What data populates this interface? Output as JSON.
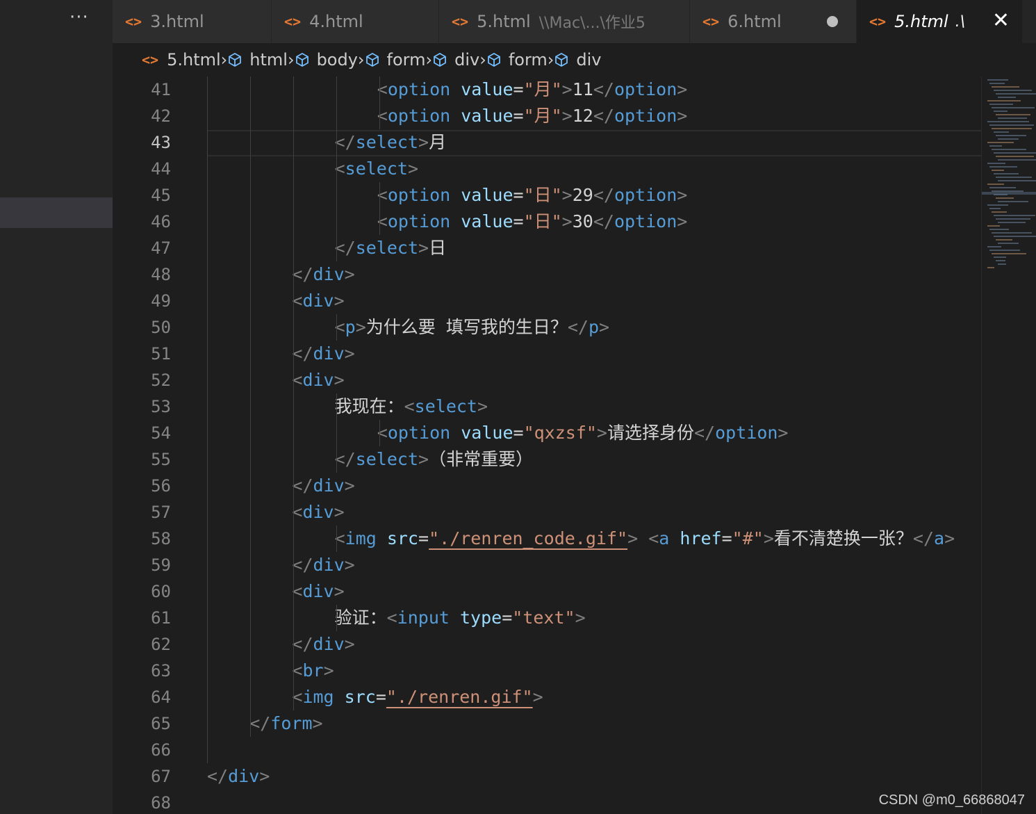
{
  "tabs": [
    {
      "label": "3.html",
      "description": "",
      "active": false,
      "dirty": false
    },
    {
      "label": "4.html",
      "description": "",
      "active": false,
      "dirty": false
    },
    {
      "label": "5.html",
      "description": "\\\\Mac\\...\\作业5",
      "active": false,
      "dirty": false
    },
    {
      "label": "6.html",
      "description": "",
      "active": false,
      "dirty": true
    },
    {
      "label": "5.html",
      "description": ".\\",
      "active": true,
      "dirty": false
    }
  ],
  "breadcrumbs": [
    {
      "label": "5.html",
      "icon": "html-file-icon"
    },
    {
      "label": "html",
      "icon": "cube-icon"
    },
    {
      "label": "body",
      "icon": "cube-icon"
    },
    {
      "label": "form",
      "icon": "cube-icon"
    },
    {
      "label": "div",
      "icon": "cube-icon"
    },
    {
      "label": "form",
      "icon": "cube-icon"
    },
    {
      "label": "div",
      "icon": "cube-icon"
    }
  ],
  "current_line": 43,
  "code_lines": [
    {
      "n": 41,
      "indent": 8,
      "tokens": [
        [
          "br",
          "<"
        ],
        [
          "tag",
          "option"
        ],
        [
          "tx",
          " "
        ],
        [
          "at",
          "value"
        ],
        [
          "tx",
          "="
        ],
        [
          "st",
          "\"月\""
        ],
        [
          "br",
          ">"
        ],
        [
          "tx",
          "11"
        ],
        [
          "br",
          "</"
        ],
        [
          "tag",
          "option"
        ],
        [
          "br",
          ">"
        ]
      ]
    },
    {
      "n": 42,
      "indent": 8,
      "tokens": [
        [
          "br",
          "<"
        ],
        [
          "tag",
          "option"
        ],
        [
          "tx",
          " "
        ],
        [
          "at",
          "value"
        ],
        [
          "tx",
          "="
        ],
        [
          "st",
          "\"月\""
        ],
        [
          "br",
          ">"
        ],
        [
          "tx",
          "12"
        ],
        [
          "br",
          "</"
        ],
        [
          "tag",
          "option"
        ],
        [
          "br",
          ">"
        ]
      ]
    },
    {
      "n": 43,
      "indent": 6,
      "tokens": [
        [
          "br",
          "</"
        ],
        [
          "tag",
          "select"
        ],
        [
          "br",
          ">"
        ],
        [
          "tx",
          "月"
        ]
      ]
    },
    {
      "n": 44,
      "indent": 6,
      "tokens": [
        [
          "br",
          "<"
        ],
        [
          "tag",
          "select"
        ],
        [
          "br",
          ">"
        ]
      ]
    },
    {
      "n": 45,
      "indent": 8,
      "tokens": [
        [
          "br",
          "<"
        ],
        [
          "tag",
          "option"
        ],
        [
          "tx",
          " "
        ],
        [
          "at",
          "value"
        ],
        [
          "tx",
          "="
        ],
        [
          "st",
          "\"日\""
        ],
        [
          "br",
          ">"
        ],
        [
          "tx",
          "29"
        ],
        [
          "br",
          "</"
        ],
        [
          "tag",
          "option"
        ],
        [
          "br",
          ">"
        ]
      ]
    },
    {
      "n": 46,
      "indent": 8,
      "tokens": [
        [
          "br",
          "<"
        ],
        [
          "tag",
          "option"
        ],
        [
          "tx",
          " "
        ],
        [
          "at",
          "value"
        ],
        [
          "tx",
          "="
        ],
        [
          "st",
          "\"日\""
        ],
        [
          "br",
          ">"
        ],
        [
          "tx",
          "30"
        ],
        [
          "br",
          "</"
        ],
        [
          "tag",
          "option"
        ],
        [
          "br",
          ">"
        ]
      ]
    },
    {
      "n": 47,
      "indent": 6,
      "tokens": [
        [
          "br",
          "</"
        ],
        [
          "tag",
          "select"
        ],
        [
          "br",
          ">"
        ],
        [
          "tx",
          "日"
        ]
      ]
    },
    {
      "n": 48,
      "indent": 4,
      "tokens": [
        [
          "br",
          "</"
        ],
        [
          "tag",
          "div"
        ],
        [
          "br",
          ">"
        ]
      ]
    },
    {
      "n": 49,
      "indent": 4,
      "tokens": [
        [
          "br",
          "<"
        ],
        [
          "tag",
          "div"
        ],
        [
          "br",
          ">"
        ]
      ]
    },
    {
      "n": 50,
      "indent": 6,
      "tokens": [
        [
          "br",
          "<"
        ],
        [
          "tag",
          "p"
        ],
        [
          "br",
          ">"
        ],
        [
          "tx",
          "为什么要 填写我的生日？"
        ],
        [
          "br",
          "</"
        ],
        [
          "tag",
          "p"
        ],
        [
          "br",
          ">"
        ]
      ]
    },
    {
      "n": 51,
      "indent": 4,
      "tokens": [
        [
          "br",
          "</"
        ],
        [
          "tag",
          "div"
        ],
        [
          "br",
          ">"
        ]
      ]
    },
    {
      "n": 52,
      "indent": 4,
      "tokens": [
        [
          "br",
          "<"
        ],
        [
          "tag",
          "div"
        ],
        [
          "br",
          ">"
        ]
      ]
    },
    {
      "n": 53,
      "indent": 6,
      "tokens": [
        [
          "tx",
          "我现在："
        ],
        [
          "br",
          "<"
        ],
        [
          "tag",
          "select"
        ],
        [
          "br",
          ">"
        ]
      ]
    },
    {
      "n": 54,
      "indent": 8,
      "tokens": [
        [
          "br",
          "<"
        ],
        [
          "tag",
          "option"
        ],
        [
          "tx",
          " "
        ],
        [
          "at",
          "value"
        ],
        [
          "tx",
          "="
        ],
        [
          "st",
          "\"qxzsf\""
        ],
        [
          "br",
          ">"
        ],
        [
          "tx",
          "请选择身份"
        ],
        [
          "br",
          "</"
        ],
        [
          "tag",
          "option"
        ],
        [
          "br",
          ">"
        ]
      ]
    },
    {
      "n": 55,
      "indent": 6,
      "tokens": [
        [
          "br",
          "</"
        ],
        [
          "tag",
          "select"
        ],
        [
          "br",
          ">"
        ],
        [
          "tx",
          "（非常重要）"
        ]
      ]
    },
    {
      "n": 56,
      "indent": 4,
      "tokens": [
        [
          "br",
          "</"
        ],
        [
          "tag",
          "div"
        ],
        [
          "br",
          ">"
        ]
      ]
    },
    {
      "n": 57,
      "indent": 4,
      "tokens": [
        [
          "br",
          "<"
        ],
        [
          "tag",
          "div"
        ],
        [
          "br",
          ">"
        ]
      ]
    },
    {
      "n": 58,
      "indent": 6,
      "tokens": [
        [
          "br",
          "<"
        ],
        [
          "tag",
          "img"
        ],
        [
          "tx",
          " "
        ],
        [
          "at",
          "src"
        ],
        [
          "tx",
          "="
        ],
        [
          "st",
          "\"./renren_code.gif\"",
          "ul"
        ],
        [
          "br",
          ">"
        ],
        [
          "tx",
          " "
        ],
        [
          "br",
          "<"
        ],
        [
          "tag",
          "a"
        ],
        [
          "tx",
          " "
        ],
        [
          "at",
          "href"
        ],
        [
          "tx",
          "="
        ],
        [
          "st",
          "\"#\""
        ],
        [
          "br",
          ">"
        ],
        [
          "tx",
          "看不清楚换一张？"
        ],
        [
          "br",
          "</"
        ],
        [
          "tag",
          "a"
        ],
        [
          "br",
          ">"
        ]
      ]
    },
    {
      "n": 59,
      "indent": 4,
      "tokens": [
        [
          "br",
          "</"
        ],
        [
          "tag",
          "div"
        ],
        [
          "br",
          ">"
        ]
      ]
    },
    {
      "n": 60,
      "indent": 4,
      "tokens": [
        [
          "br",
          "<"
        ],
        [
          "tag",
          "div"
        ],
        [
          "br",
          ">"
        ]
      ]
    },
    {
      "n": 61,
      "indent": 6,
      "tokens": [
        [
          "tx",
          "验证："
        ],
        [
          "br",
          "<"
        ],
        [
          "tag",
          "input"
        ],
        [
          "tx",
          " "
        ],
        [
          "at",
          "type"
        ],
        [
          "tx",
          "="
        ],
        [
          "st",
          "\"text\""
        ],
        [
          "br",
          ">"
        ]
      ]
    },
    {
      "n": 62,
      "indent": 4,
      "tokens": [
        [
          "br",
          "</"
        ],
        [
          "tag",
          "div"
        ],
        [
          "br",
          ">"
        ]
      ]
    },
    {
      "n": 63,
      "indent": 4,
      "tokens": [
        [
          "br",
          "<"
        ],
        [
          "tag",
          "br"
        ],
        [
          "br",
          ">"
        ]
      ]
    },
    {
      "n": 64,
      "indent": 4,
      "tokens": [
        [
          "br",
          "<"
        ],
        [
          "tag",
          "img"
        ],
        [
          "tx",
          " "
        ],
        [
          "at",
          "src"
        ],
        [
          "tx",
          "="
        ],
        [
          "st",
          "\"./renren.gif\"",
          "ul"
        ],
        [
          "br",
          ">"
        ]
      ]
    },
    {
      "n": 65,
      "indent": 2,
      "tokens": [
        [
          "br",
          "</"
        ],
        [
          "tag",
          "form"
        ],
        [
          "br",
          ">"
        ]
      ]
    },
    {
      "n": 66,
      "indent": 0,
      "tokens": []
    },
    {
      "n": 67,
      "indent": 0,
      "tokens": [
        [
          "br",
          "</"
        ],
        [
          "tag",
          "div"
        ],
        [
          "br",
          ">"
        ]
      ]
    },
    {
      "n": 68,
      "indent": 0,
      "tokens": []
    }
  ],
  "watermark": "CSDN @m0_66868047",
  "colors": {
    "background": "#1e1e1e",
    "tag": "#569cd6",
    "attribute": "#9cdcfe",
    "string": "#ce9178",
    "bracket": "#808080",
    "file_icon": "#e37933"
  }
}
